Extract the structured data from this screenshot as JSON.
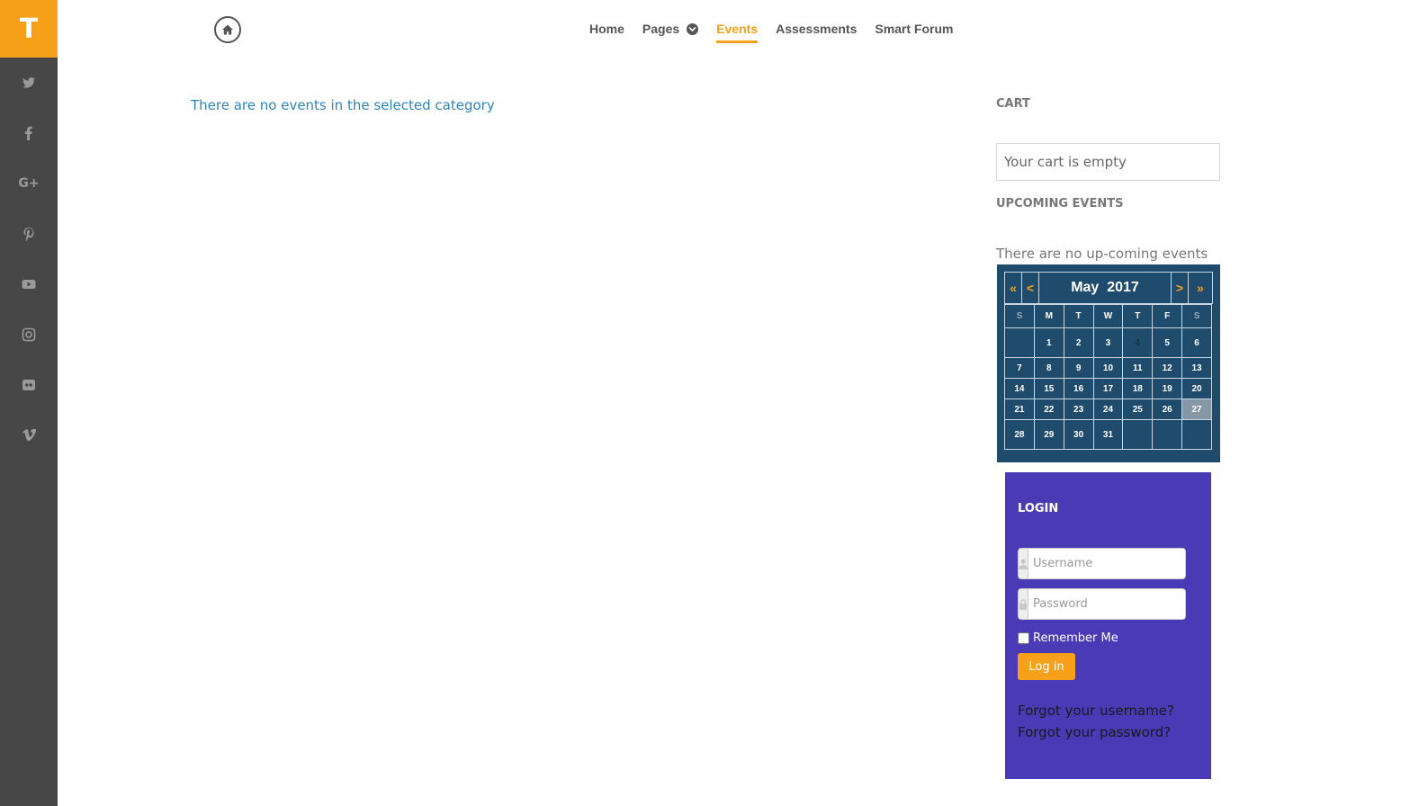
{
  "brand": {
    "logo_letter": "T",
    "accent": "#f7a11a"
  },
  "sidebar": {
    "social": [
      {
        "icon": "twitter-icon"
      },
      {
        "icon": "facebook-icon"
      },
      {
        "icon": "google-plus-icon",
        "glyph": "G+"
      },
      {
        "icon": "pinterest-icon"
      },
      {
        "icon": "youtube-icon"
      },
      {
        "icon": "instagram-icon"
      },
      {
        "icon": "flickr-icon"
      },
      {
        "icon": "vimeo-icon"
      }
    ]
  },
  "nav": {
    "home": "Home",
    "pages": "Pages",
    "events": "Events",
    "assessments": "Assessments",
    "forum": "Smart Forum"
  },
  "main": {
    "message": "There are no events in the selected category"
  },
  "cart": {
    "title": "CART",
    "empty_text": "Your cart is empty"
  },
  "upcoming": {
    "title": "UPCOMING EVENTS",
    "empty_text": "There are no up-coming events"
  },
  "calendar": {
    "prev_year": "«",
    "prev_month": "<",
    "month": "May",
    "year": "2017",
    "next_month": ">",
    "next_year": "»",
    "weekdays": [
      "S",
      "M",
      "T",
      "W",
      "T",
      "F",
      "S"
    ],
    "weeks": [
      [
        "",
        "1",
        "2",
        "3",
        "4",
        "5",
        "6"
      ],
      [
        "7",
        "8",
        "9",
        "10",
        "11",
        "12",
        "13"
      ],
      [
        "14",
        "15",
        "16",
        "17",
        "18",
        "19",
        "20"
      ],
      [
        "21",
        "22",
        "23",
        "24",
        "25",
        "26",
        "27"
      ],
      [
        "28",
        "29",
        "30",
        "31",
        "",
        "",
        ""
      ]
    ],
    "highlighted_day": "27"
  },
  "login": {
    "title": "LOGIN",
    "username_placeholder": "Username",
    "password_placeholder": "Password",
    "remember": "Remember Me",
    "button": "Log in",
    "forgot_username": "Forgot your username?",
    "forgot_password": "Forgot your password?"
  }
}
